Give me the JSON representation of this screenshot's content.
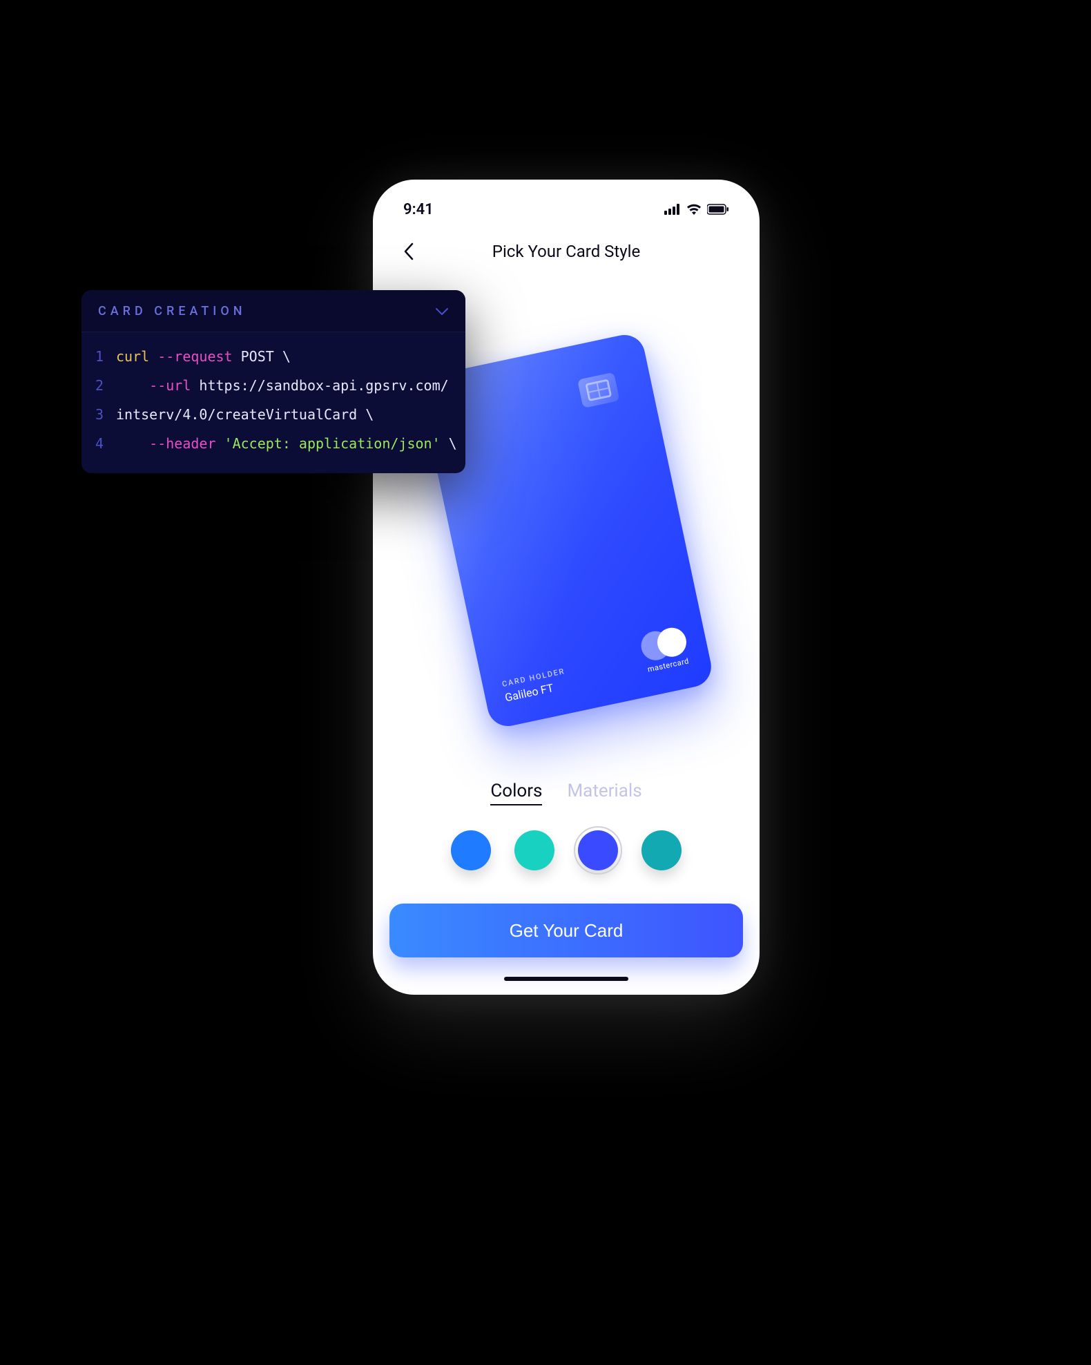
{
  "status": {
    "time": "9:41"
  },
  "nav": {
    "title": "Pick Your Card Style"
  },
  "card": {
    "holder_label": "CARD HOLDER",
    "holder_name": "Galileo FT",
    "network": "mastercard"
  },
  "tabs": {
    "colors": "Colors",
    "materials": "Materials",
    "active": "colors"
  },
  "swatches": [
    {
      "color": "#1f7bff",
      "selected": false
    },
    {
      "color": "#19d1c1",
      "selected": false
    },
    {
      "color": "#3a4bff",
      "selected": true
    },
    {
      "color": "#12a9b3",
      "selected": false
    }
  ],
  "cta_label": "Get Your Card",
  "code_panel": {
    "title": "CARD CREATION",
    "lines": [
      {
        "n": "1",
        "tokens": [
          {
            "cls": "tok-yellow",
            "t": "curl "
          },
          {
            "cls": "tok-magenta",
            "t": "--request"
          },
          {
            "cls": "tok-white",
            "t": " POST \\"
          }
        ]
      },
      {
        "n": "2",
        "tokens": [
          {
            "cls": "tok-white",
            "t": "    "
          },
          {
            "cls": "tok-magenta",
            "t": "--url"
          },
          {
            "cls": "tok-white",
            "t": " https://sandbox-api.gpsrv.com/"
          }
        ]
      },
      {
        "n": "3",
        "tokens": [
          {
            "cls": "tok-white",
            "t": "intserv/4.0/createVirtualCard \\"
          }
        ]
      },
      {
        "n": "4",
        "tokens": [
          {
            "cls": "tok-white",
            "t": "    "
          },
          {
            "cls": "tok-magenta",
            "t": "--header"
          },
          {
            "cls": "tok-green",
            "t": " 'Accept: application/json'"
          },
          {
            "cls": "tok-white",
            "t": " \\"
          }
        ]
      }
    ]
  }
}
